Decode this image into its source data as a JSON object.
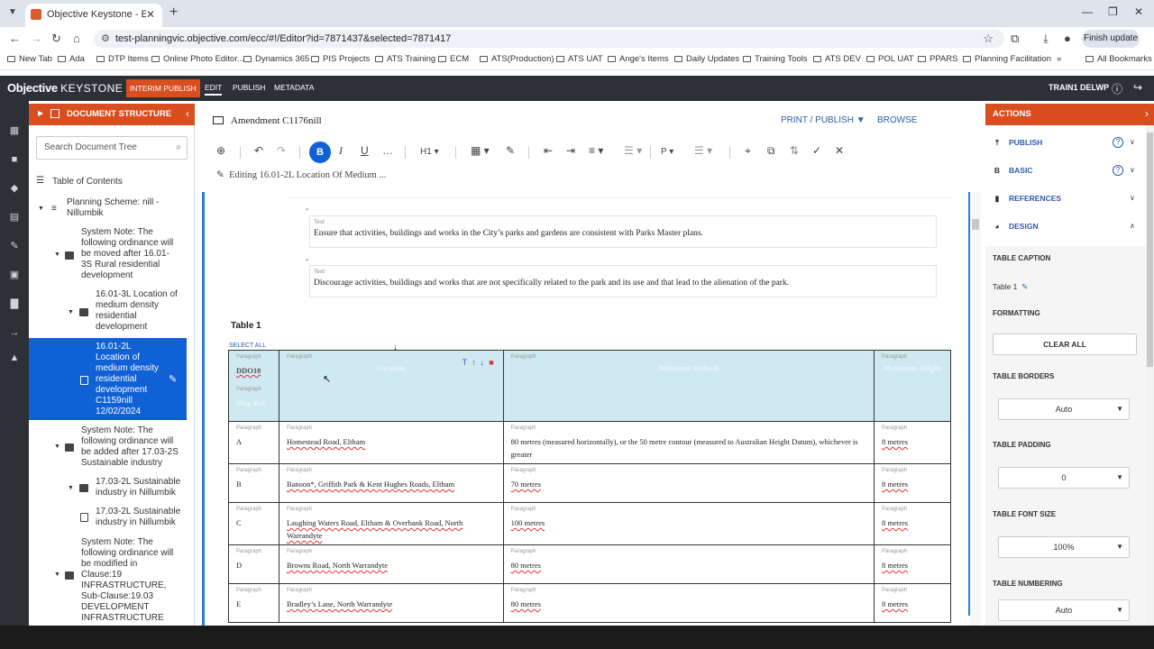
{
  "browser": {
    "tab_title": "Objective Keystone - Editor: Am",
    "url": "test-planningvic.objective.com/ecc/#!/Editor?id=7871437&selected=7871417",
    "finish_update": "Finish update",
    "bookmarks": [
      "New Tab",
      "Ada",
      "DTP Items",
      "Online Photo Editor...",
      "Dynamics 365",
      "PIS Projects",
      "ATS Training",
      "ECM",
      "ATS(Production)",
      "ATS UAT",
      "Ange's Items",
      "Daily Updates",
      "Training Tools",
      "ATS DEV",
      "POL UAT",
      "PPARS",
      "Planning Facilitation"
    ],
    "all_bookmarks": "All Bookmarks"
  },
  "app": {
    "logo_main": "Objective",
    "logo_sub": "KEYSTONE",
    "interim_publish": "INTERIM PUBLISH",
    "tabs": [
      "EDIT",
      "PUBLISH",
      "METADATA"
    ],
    "user": "TRAIN1 DELWP"
  },
  "doc_structure": {
    "title": "DOCUMENT STRUCTURE",
    "search_placeholder": "Search Document Tree",
    "toc": "Table of Contents",
    "items": [
      "Planning Scheme: nill - Nillumbik",
      "System Note: The following ordinance will be moved after 16.01-3S Rural residential development",
      "16.01-3L Location of medium density residential development",
      "16.01-2L Location of medium density residential development C1159nill 12/02/2024",
      "System Note: The following ordinance will be added after 17.03-2S Sustainable industry",
      "17.03-2L Sustainable industry in Nillumbik",
      "17.03-2L Sustainable industry in Nillumbik",
      "System Note: The following ordinance will be modified in Clause:19 INFRASTRUCTURE, Sub-Clause:19.03 DEVELOPMENT INFRASTRUCTURE"
    ]
  },
  "editor": {
    "doc_title": "Amendment C1176nill",
    "print_publish": "PRINT / PUBLISH ▼",
    "browse": "BROWSE",
    "heading_sel": "H1",
    "para_sel": "P",
    "editing": "Editing 16.01-2L Location Of Medium ...",
    "text_label": "Text",
    "dash": "-",
    "text1": "Ensure that activities, buildings and works in the City’s parks and gardens are consistent with Parks Master plans.",
    "text2": "Discourage activities, buildings and works that are not specifically related to the park and its use and that lead to the alienation of the park.",
    "table_caption": "Table 1",
    "select_all": "SELECT ALL",
    "paragraph_label": "Paragraph",
    "header": {
      "c1": "DDO10",
      "c1b": "Map Ref",
      "c2": "Location",
      "c3": "Minimum Setback",
      "c4": "Maximum Height"
    },
    "rows": [
      {
        "ref": "A",
        "loc": "Homestead Road, Eltham",
        "setback": "80 metres (measured horizontally), or the 50 metre contour (measured to Australian Height Datum), whichever is greater",
        "height": "8 metres"
      },
      {
        "ref": "B",
        "loc": "Banoon*, Griffith Park & Kent Hughes Roads, Eltham",
        "setback": "70 metres",
        "height": "8 metres"
      },
      {
        "ref": "C",
        "loc": "Laughing Waters Road, Eltham & Overbank Road, North Warrandyte",
        "setback": "100 metres",
        "height": "8 metres"
      },
      {
        "ref": "D",
        "loc": "Browns Road, North Warrandyte",
        "setback": "80 metres",
        "height": "8 metres"
      },
      {
        "ref": "E",
        "loc": "Bradley’s Lane, North Warrandyte",
        "setback": "80 metres",
        "height": "8 metres"
      }
    ]
  },
  "actions": {
    "title": "ACTIONS",
    "items": [
      "PUBLISH",
      "BASIC",
      "REFERENCES",
      "DESIGN"
    ],
    "table_caption_lbl": "TABLE CAPTION",
    "table_caption_val": "Table 1",
    "formatting_lbl": "FORMATTING",
    "clear_all": "CLEAR ALL",
    "borders_lbl": "TABLE BORDERS",
    "borders_val": "Auto",
    "padding_lbl": "TABLE PADDING",
    "padding_val": "0",
    "font_lbl": "TABLE FONT SIZE",
    "font_val": "100%",
    "numbering_lbl": "TABLE NUMBERING",
    "numbering_val": "Auto"
  },
  "colors": {
    "accent": "#d94e1f",
    "header_bg": "#2d3137",
    "selected": "#1061d6",
    "link": "#2d5ca8"
  }
}
